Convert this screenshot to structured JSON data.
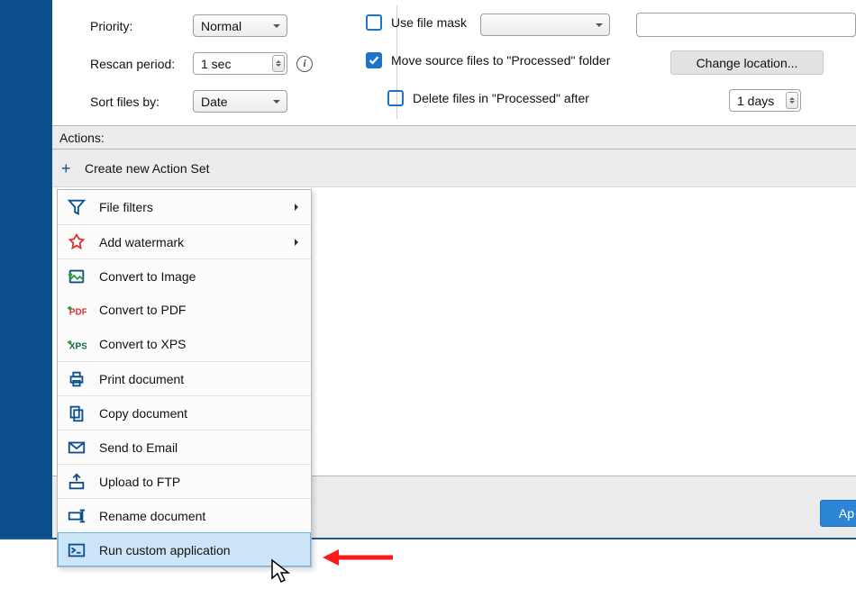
{
  "form": {
    "priority": {
      "label": "Priority:",
      "value": "Normal"
    },
    "rescan": {
      "label": "Rescan period:",
      "value": "1 sec"
    },
    "sort": {
      "label": "Sort files by:",
      "value": "Date"
    },
    "usemask": {
      "label": "Use file mask",
      "checked": false
    },
    "movesrc": {
      "label": "Move source files to \"Processed\" folder",
      "checked": true
    },
    "changeloc": {
      "label": "Change location..."
    },
    "deleteafter": {
      "label": "Delete files in \"Processed\" after",
      "checked": false
    },
    "deletedays": {
      "value": "1 days"
    }
  },
  "actions": {
    "header": "Actions:",
    "create": "Create new Action Set"
  },
  "menu": {
    "items": [
      {
        "label": "File filters",
        "sub": true
      },
      {
        "label": "Add watermark",
        "sub": true
      },
      {
        "label": "Convert to Image"
      },
      {
        "label": "Convert to PDF"
      },
      {
        "label": "Convert to XPS"
      },
      {
        "label": "Print document"
      },
      {
        "label": "Copy document"
      },
      {
        "label": "Send to Email"
      },
      {
        "label": "Upload to FTP"
      },
      {
        "label": "Rename document"
      },
      {
        "label": "Run custom application"
      }
    ]
  },
  "apply_fragment": "Ap"
}
